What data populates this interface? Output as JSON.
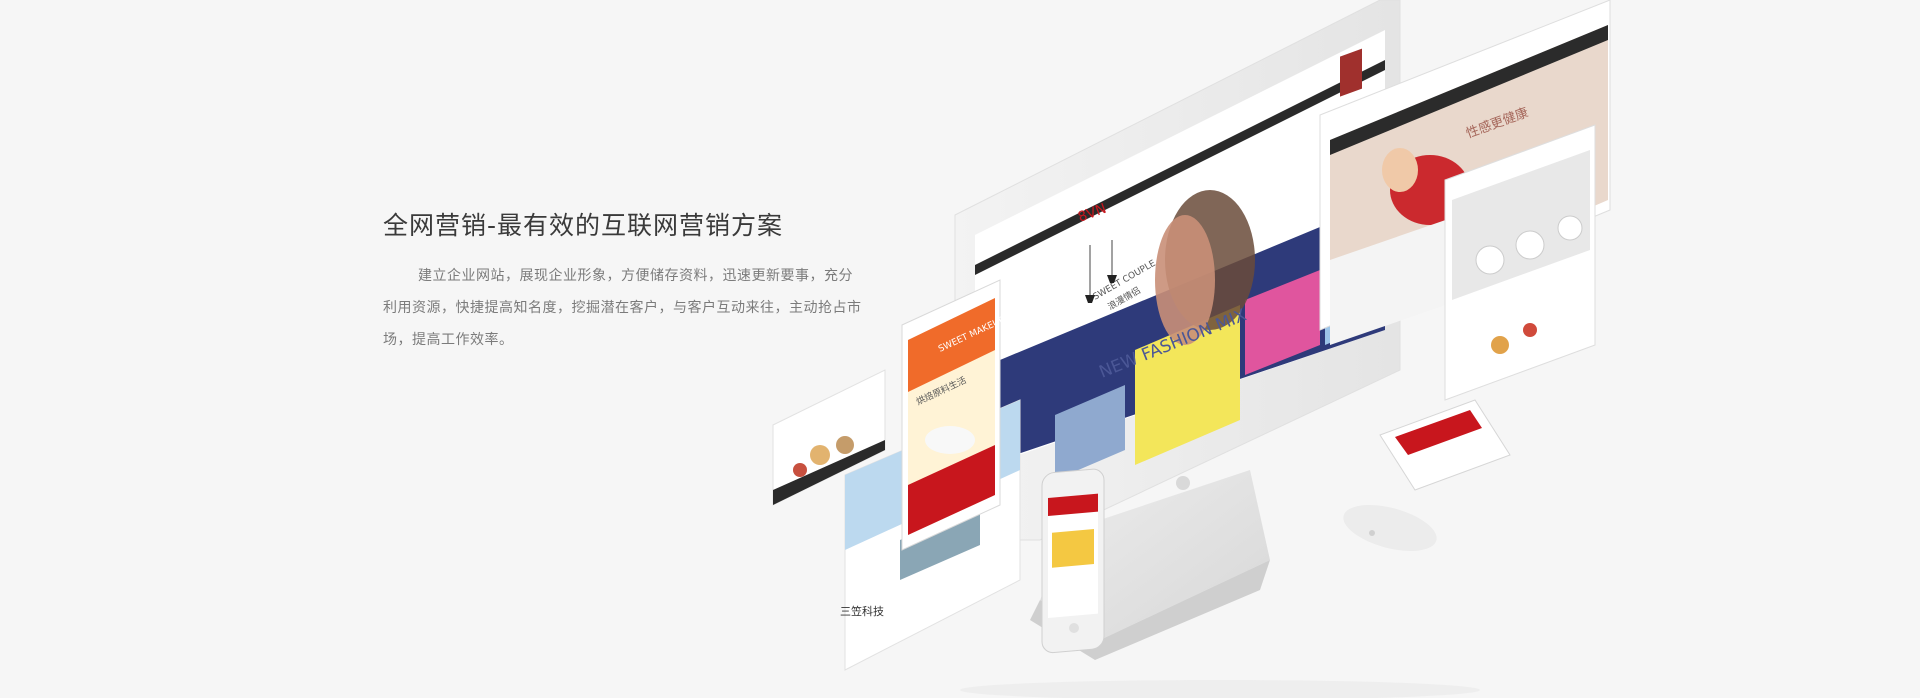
{
  "banner": {
    "headline": "全网营销-最有效的互联网营销方案",
    "description": "建立企业网站，展现企业形象，方便储存资料，迅速更新要事，充分利用资源，快捷提高知名度，挖掘潜在客户，与客户互动来往，主动抢占市场，提高工作效率。"
  },
  "devices": {
    "imac_brand": "8VN",
    "imac_tagline": "SWEET COUPLE",
    "imac_tagline_cn": "浪漫情侣",
    "imac_banner_text": "NEW FASHION MIX",
    "tablet_title": "性感更健康",
    "phone_title": "SWEET MAKEUP",
    "phone_subtitle": "烘焙原料生活",
    "card_logo": "三笠科技"
  },
  "colors": {
    "background": "#f6f6f6",
    "headline": "#3a3a3a",
    "description": "#7b7b7b",
    "accent_red": "#c8161d",
    "accent_navy": "#2e3a7a",
    "accent_pink": "#e0559e",
    "accent_yellow": "#f3e65a"
  }
}
